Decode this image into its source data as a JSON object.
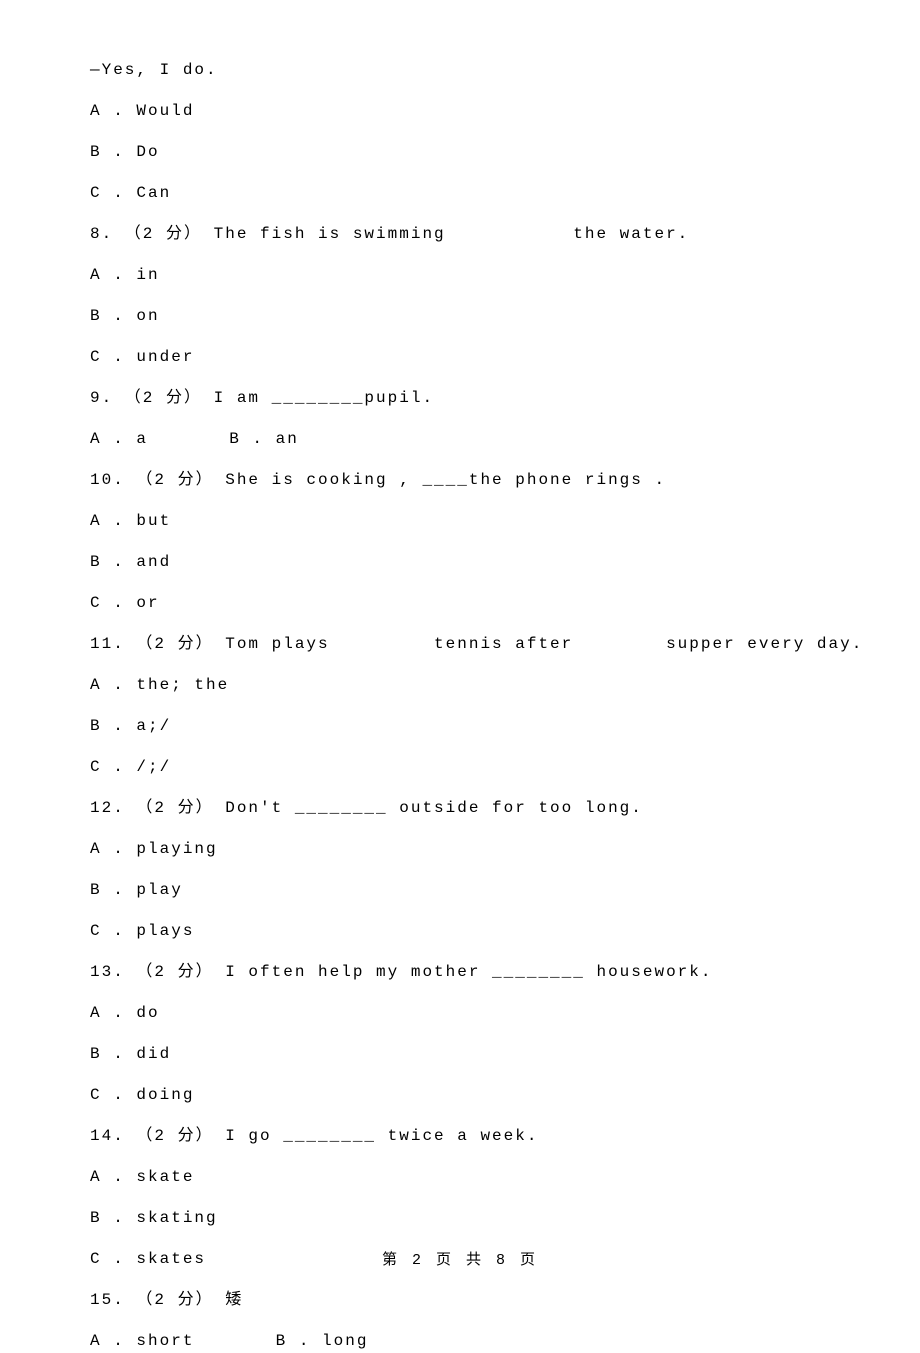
{
  "intro": {
    "answer": "—Yes, I do.",
    "opts": [
      "A . Would",
      "B . Do",
      "C . Can"
    ]
  },
  "q8": {
    "stem": "8. （2 分） The fish is swimming           the water.",
    "opts": [
      "A . in",
      "B . on",
      "C . under"
    ]
  },
  "q9": {
    "stem": "9. （2 分） I am ________pupil.",
    "opts": "A . a       B . an"
  },
  "q10": {
    "stem": "10. （2 分） She is cooking , ____the phone rings .",
    "opts": [
      "A . but",
      "B . and",
      "C . or"
    ]
  },
  "q11": {
    "stem": "11. （2 分） Tom plays         tennis after        supper every day.",
    "opts": [
      "A . the; the",
      "B . a;/",
      "C . /;/"
    ]
  },
  "q12": {
    "stem": "12. （2 分） Don't ________ outside for too long.",
    "opts": [
      "A . playing",
      "B . play",
      "C . plays"
    ]
  },
  "q13": {
    "stem": "13. （2 分） I often help my mother ________ housework.",
    "opts": [
      "A . do",
      "B . did",
      "C . doing"
    ]
  },
  "q14": {
    "stem": "14. （2 分） I go ________ twice a week.",
    "opts": [
      "A . skate",
      "B . skating",
      "C . skates"
    ]
  },
  "q15": {
    "stem": "15. （2 分） 矮",
    "opts": "A . short       B . long"
  },
  "footer": "第 2 页 共 8 页"
}
